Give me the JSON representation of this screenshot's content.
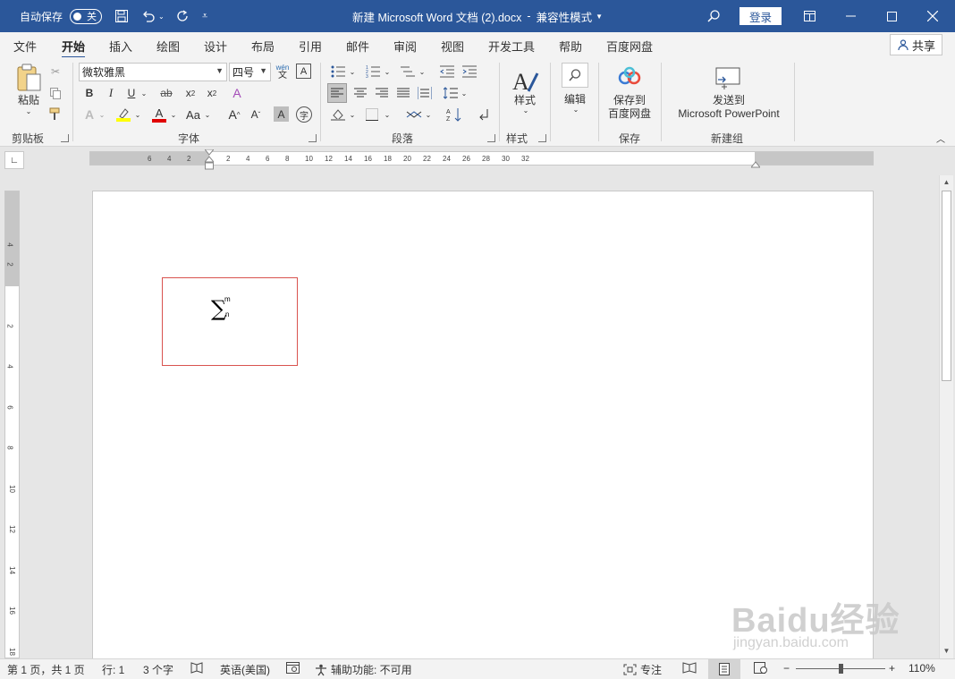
{
  "titlebar": {
    "autosave_label": "自动保存",
    "autosave_state": "关",
    "doc_title": "新建 Microsoft Word 文档 (2).docx",
    "sep": "-",
    "mode": "兼容性模式",
    "login_label": "登录"
  },
  "tabs": [
    "文件",
    "开始",
    "插入",
    "绘图",
    "设计",
    "布局",
    "引用",
    "邮件",
    "审阅",
    "视图",
    "开发工具",
    "帮助",
    "百度网盘"
  ],
  "active_tab": "开始",
  "share_label": "共享",
  "ribbon": {
    "clipboard": {
      "paste_label": "粘贴",
      "group_label": "剪贴板"
    },
    "font": {
      "font_name": "微软雅黑",
      "font_size": "四号",
      "group_label": "字体",
      "phonetic_top": "wén",
      "phonetic_bottom": "文",
      "case_label": "Aa"
    },
    "paragraph": {
      "group_label": "段落"
    },
    "styles": {
      "label": "样式",
      "group_label": "样式"
    },
    "editing": {
      "label": "编辑"
    },
    "save": {
      "line1": "保存到",
      "line2": "百度网盘",
      "group_label": "保存"
    },
    "newgroup": {
      "line1": "发送到",
      "line2": "Microsoft PowerPoint",
      "group_label": "新建组"
    }
  },
  "ruler": {
    "h_left": [
      "6",
      "4",
      "2"
    ],
    "h_right": [
      "2",
      "4",
      "6",
      "8",
      "10",
      "12",
      "14",
      "16",
      "18",
      "20",
      "22",
      "24",
      "26",
      "28",
      "30",
      "32"
    ],
    "v_top": [
      "4",
      "2"
    ],
    "v_body": [
      "2",
      "4",
      "6",
      "8",
      "10",
      "12",
      "14",
      "16",
      "18"
    ]
  },
  "document": {
    "equation": {
      "symbol": "∑",
      "upper": "m",
      "lower": "n"
    }
  },
  "watermark": {
    "line1": "Baidu经验",
    "line2": "jingyan.baidu.com"
  },
  "statusbar": {
    "page": "第 1 页，共 1 页",
    "line": "行: 1",
    "words": "3 个字",
    "language": "英语(美国)",
    "accessibility": "辅助功能: 不可用",
    "focus": "专注",
    "zoom": "110%",
    "zoom_level_fraction": 0.5
  },
  "colors": {
    "title_bg": "#2b579a",
    "equation_box_border": "#d9534f",
    "highlight": "#ffff00",
    "font_color": "#e00000"
  }
}
